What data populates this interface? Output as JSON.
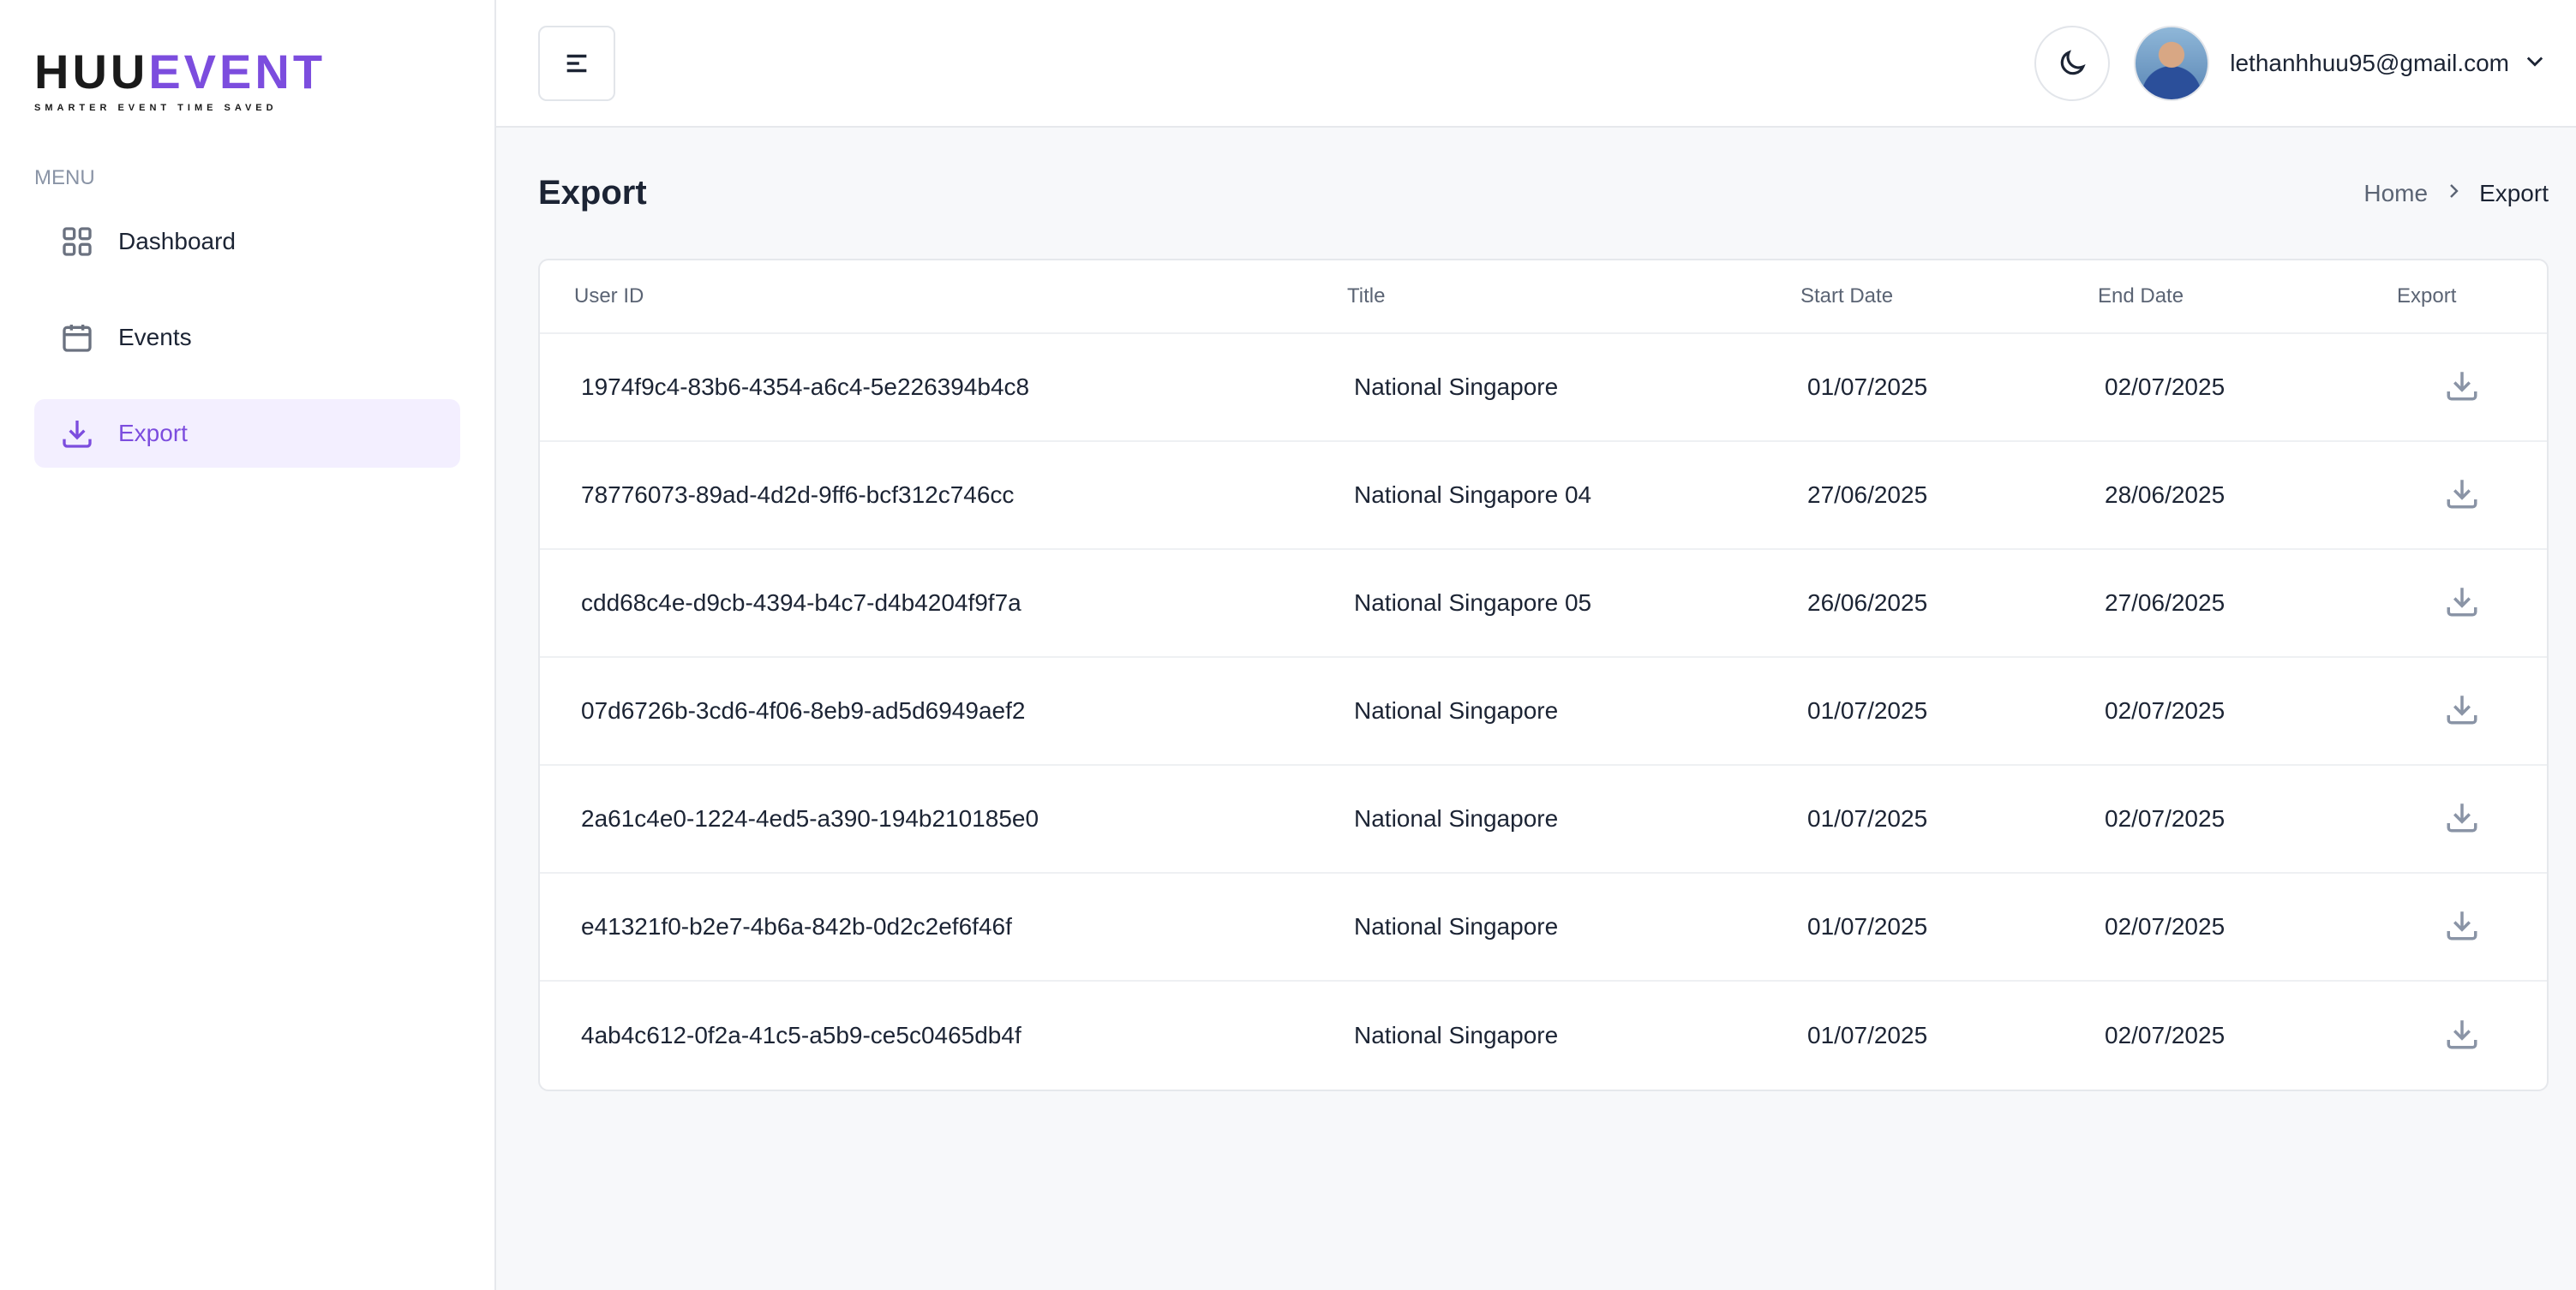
{
  "brand": {
    "name_part1": "HUU",
    "name_part2": "EVENT",
    "tagline": "SMARTER EVENT TIME SAVED"
  },
  "sidebar": {
    "menu_label": "MENU",
    "items": [
      {
        "label": "Dashboard",
        "icon": "grid-icon",
        "active": false
      },
      {
        "label": "Events",
        "icon": "calendar-icon",
        "active": false
      },
      {
        "label": "Export",
        "icon": "download-icon",
        "active": true
      }
    ]
  },
  "header": {
    "user_email": "lethanhhuu95@gmail.com"
  },
  "page": {
    "title": "Export",
    "breadcrumb": {
      "home": "Home",
      "current": "Export"
    }
  },
  "table": {
    "columns": [
      "User ID",
      "Title",
      "Start Date",
      "End Date",
      "Export"
    ],
    "rows": [
      {
        "user_id": "1974f9c4-83b6-4354-a6c4-5e226394b4c8",
        "title": "National Singapore",
        "start": "01/07/2025",
        "end": "02/07/2025"
      },
      {
        "user_id": "78776073-89ad-4d2d-9ff6-bcf312c746cc",
        "title": "National Singapore 04",
        "start": "27/06/2025",
        "end": "28/06/2025"
      },
      {
        "user_id": "cdd68c4e-d9cb-4394-b4c7-d4b4204f9f7a",
        "title": "National Singapore 05",
        "start": "26/06/2025",
        "end": "27/06/2025"
      },
      {
        "user_id": "07d6726b-3cd6-4f06-8eb9-ad5d6949aef2",
        "title": "National Singapore",
        "start": "01/07/2025",
        "end": "02/07/2025"
      },
      {
        "user_id": "2a61c4e0-1224-4ed5-a390-194b210185e0",
        "title": "National Singapore",
        "start": "01/07/2025",
        "end": "02/07/2025"
      },
      {
        "user_id": "e41321f0-b2e7-4b6a-842b-0d2c2ef6f46f",
        "title": "National Singapore",
        "start": "01/07/2025",
        "end": "02/07/2025"
      },
      {
        "user_id": "4ab4c612-0f2a-41c5-a5b9-ce5c0465db4f",
        "title": "National Singapore",
        "start": "01/07/2025",
        "end": "02/07/2025"
      }
    ]
  },
  "colors": {
    "accent": "#7c4dde",
    "active_bg": "#f3efff",
    "text": "#1c2434",
    "muted": "#8a94a6"
  }
}
